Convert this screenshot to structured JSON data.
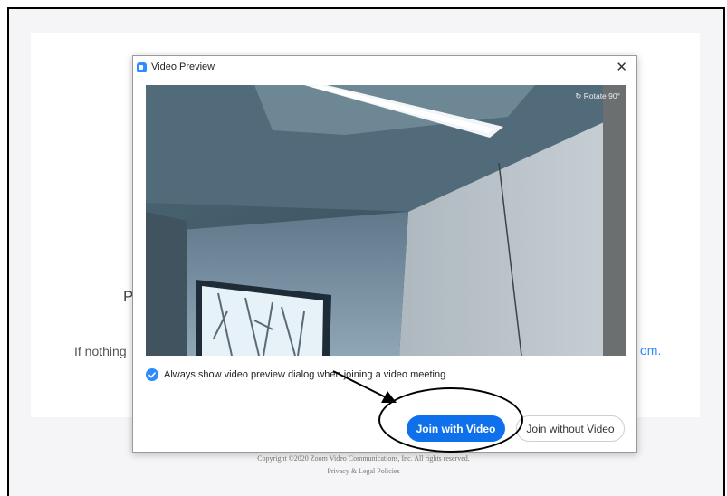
{
  "background": {
    "partial_text_left": "P",
    "partial_text_row": "If nothing",
    "partial_text_right": "om."
  },
  "footer": {
    "copyright": "Copyright ©2020 Zoom Video Communications, Inc. All rights reserved.",
    "privacy": "Privacy & Legal Policies"
  },
  "dialog": {
    "title": "Video Preview",
    "close_glyph": "✕",
    "rotate_label": "Rotate 90°",
    "always_show_label": "Always show video preview dialog when joining a video meeting",
    "always_show_checked": true,
    "join_with_video": "Join with Video",
    "join_without_video": "Join without Video"
  },
  "colors": {
    "accent": "#0e71eb",
    "checkbox": "#2d8cff"
  }
}
